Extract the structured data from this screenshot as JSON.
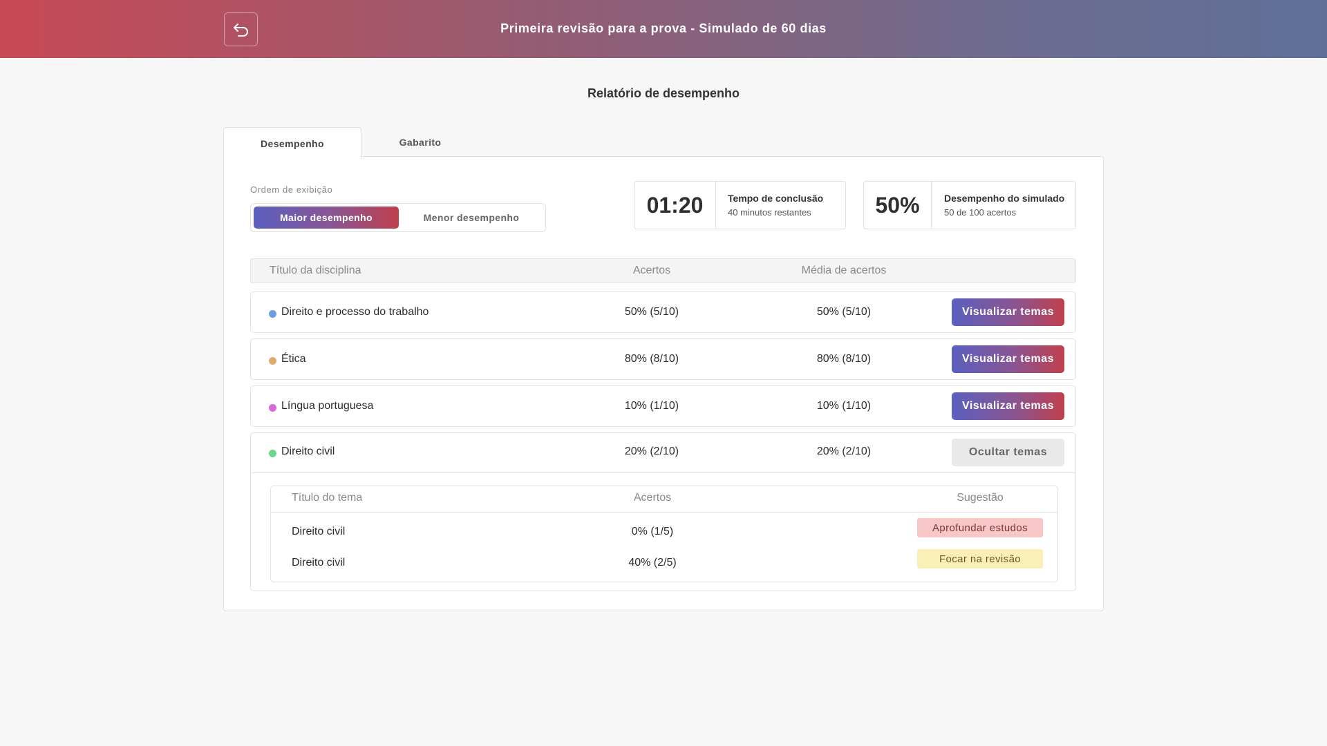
{
  "header": {
    "title": "Primeira revisão para a prova - Simulado de 60 dias",
    "back_icon": "undo-arrow-icon"
  },
  "page": {
    "heading": "Relatório de desempenho"
  },
  "tabs": [
    {
      "label": "Desempenho",
      "active": true
    },
    {
      "label": "Gabarito",
      "active": false
    }
  ],
  "order": {
    "label": "Ordem de exibição",
    "options": [
      "Maior desempenho",
      "Menor desempenho"
    ],
    "selected": "Maior desempenho"
  },
  "stats": {
    "time": {
      "value": "01:20",
      "title": "Tempo de conclusão",
      "subtitle": "40 minutos restantes"
    },
    "performance": {
      "value": "50%",
      "title": "Desempenho do simulado",
      "subtitle": "50 de 100 acertos"
    }
  },
  "table": {
    "headers": [
      "Título da disciplina",
      "Acertos",
      "Média de acertos"
    ],
    "rows": [
      {
        "name": "Direito e processo do trabalho",
        "acertos": "50% (5/10)",
        "media": "50% (5/10)",
        "color": "#6a9ee0",
        "action": "Visualizar temas"
      },
      {
        "name": "Ética",
        "acertos": "80% (8/10)",
        "media": "80% (8/10)",
        "color": "#e0a86a",
        "action": "Visualizar temas"
      },
      {
        "name": "Língua portuguesa",
        "acertos": "10% (1/10)",
        "media": "10% (1/10)",
        "color": "#d86ad8",
        "action": "Visualizar temas"
      },
      {
        "name": "Direito civil",
        "acertos": "20% (2/10)",
        "media": "20% (2/10)",
        "color": "#6ad88a",
        "action": "Ocultar temas"
      }
    ]
  },
  "themes": {
    "headers": [
      "Título do tema",
      "Acertos",
      "Sugestão"
    ],
    "rows": [
      {
        "name": "Direito civil",
        "acertos": "0% (1/5)",
        "sugestao": "Aprofundar estudos",
        "badge_bg": "#f8c6c6",
        "badge_fg": "#7a3636"
      },
      {
        "name": "Direito civil",
        "acertos": "40% (2/5)",
        "sugestao": "Focar na revisão",
        "badge_bg": "#fbefb8",
        "badge_fg": "#6b5a1d"
      }
    ]
  }
}
